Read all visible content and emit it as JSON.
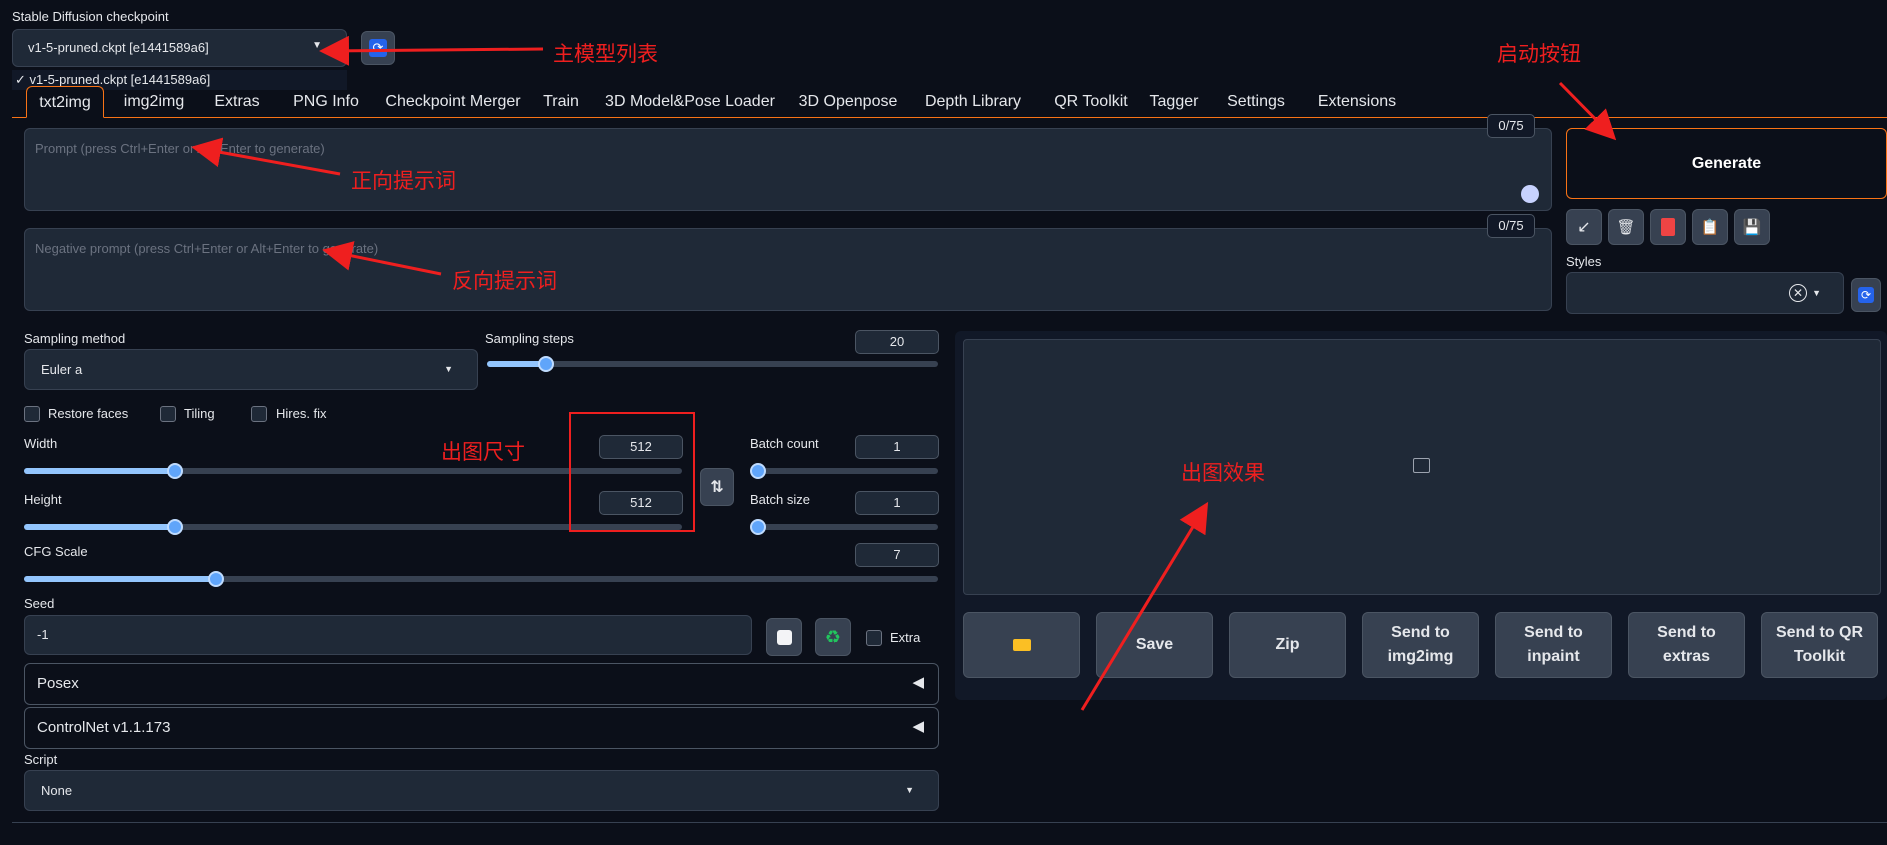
{
  "checkpoint": {
    "label": "Stable Diffusion checkpoint",
    "value": "v1-5-pruned.ckpt [e1441589a6]",
    "dropdown_option": "✓ v1-5-pruned.ckpt [e1441589a6]"
  },
  "tabs": [
    "txt2img",
    "img2img",
    "Extras",
    "PNG Info",
    "Checkpoint Merger",
    "Train",
    "3D Model&Pose Loader",
    "3D Openpose",
    "Depth Library",
    "QR Toolkit",
    "Tagger",
    "Settings",
    "Extensions"
  ],
  "prompt": {
    "placeholder": "Prompt (press Ctrl+Enter or Alt+Enter to generate)",
    "token_count": "0/75"
  },
  "negative_prompt": {
    "placeholder": "Negative prompt (press Ctrl+Enter or Alt+Enter to generate)",
    "token_count": "0/75"
  },
  "generate_label": "Generate",
  "styles_label": "Styles",
  "sampling": {
    "method_label": "Sampling method",
    "method_value": "Euler a",
    "steps_label": "Sampling steps",
    "steps_value": "20",
    "steps_fraction": 0.13
  },
  "checkboxes": {
    "restore_faces": "Restore faces",
    "tiling": "Tiling",
    "hires_fix": "Hires. fix",
    "extra": "Extra"
  },
  "width": {
    "label": "Width",
    "value": "512",
    "fraction": 0.23
  },
  "height": {
    "label": "Height",
    "value": "512",
    "fraction": 0.23
  },
  "batch_count": {
    "label": "Batch count",
    "value": "1",
    "fraction": 0.0
  },
  "batch_size": {
    "label": "Batch size",
    "value": "1",
    "fraction": 0.0
  },
  "cfg": {
    "label": "CFG Scale",
    "value": "7",
    "fraction": 0.21
  },
  "seed": {
    "label": "Seed",
    "value": "-1"
  },
  "accordions": {
    "posex": "Posex",
    "controlnet": "ControlNet v1.1.173"
  },
  "script": {
    "label": "Script",
    "value": "None"
  },
  "output_buttons": {
    "save": "Save",
    "zip": "Zip",
    "send_img2img": "Send to img2img",
    "send_inpaint": "Send to inpaint",
    "send_extras": "Send to extras",
    "send_qr": "Send to QR Toolkit"
  },
  "annotations": {
    "model_list": "主模型列表",
    "start_button": "启动按钮",
    "positive_prompt": "正向提示词",
    "negative_prompt": "反向提示词",
    "image_size": "出图尺寸",
    "image_result": "出图效果"
  },
  "colors": {
    "background": "#0b0f19",
    "panel": "#1f2937",
    "accent": "#f97316",
    "slider": "#60a5fa",
    "annotation": "#ef1f1f"
  }
}
